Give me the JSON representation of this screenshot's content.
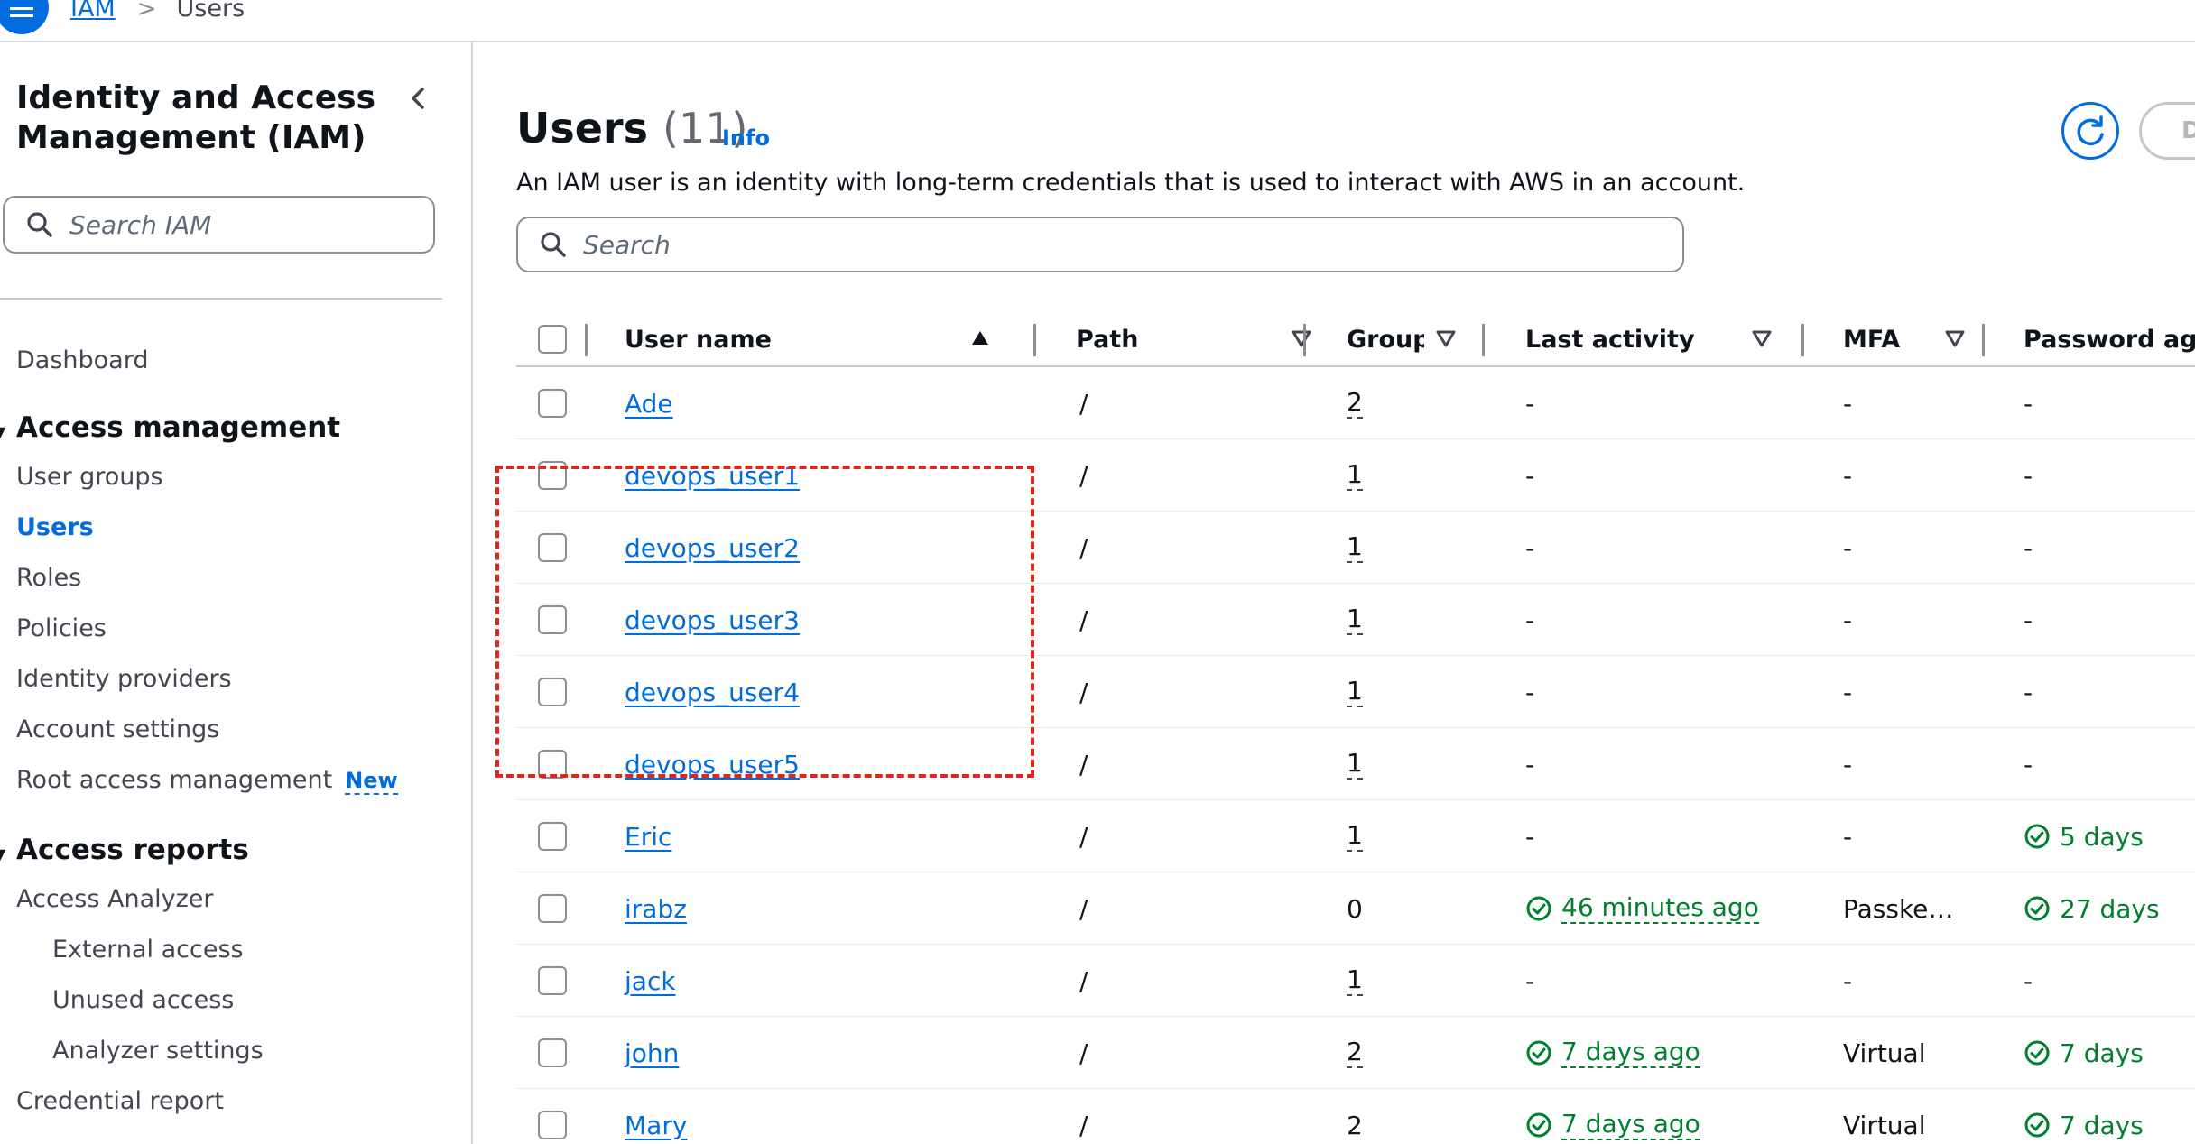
{
  "breadcrumb": {
    "root": "IAM",
    "separator": ">",
    "current": "Users"
  },
  "sidebar": {
    "title": "Identity and Access Management (IAM)",
    "search_placeholder": "Search IAM",
    "dashboard": "Dashboard",
    "access_management": {
      "heading": "Access management",
      "items": [
        "User groups",
        "Users",
        "Roles",
        "Policies",
        "Identity providers",
        "Account settings",
        "Root access management"
      ],
      "new_badge": "New"
    },
    "access_reports": {
      "heading": "Access reports",
      "analyzer": "Access Analyzer",
      "analyzer_items": [
        "External access",
        "Unused access",
        "Analyzer settings"
      ],
      "credential_report": "Credential report"
    }
  },
  "main": {
    "title": "Users",
    "count": "(11)",
    "info": "Info",
    "description": "An IAM user is an identity with long-term credentials that is used to interact with AWS in an account.",
    "search_placeholder": "Search",
    "partial_button": "D"
  },
  "table": {
    "columns": [
      "User name",
      "Path",
      "Groups",
      "Last activity",
      "MFA",
      "Password age"
    ],
    "rows": [
      {
        "name": "Ade",
        "path": "/",
        "groups": "2",
        "last_activity": "-",
        "mfa": "-",
        "password_age": "-"
      },
      {
        "name": "devops_user1",
        "path": "/",
        "groups": "1",
        "last_activity": "-",
        "mfa": "-",
        "password_age": "-"
      },
      {
        "name": "devops_user2",
        "path": "/",
        "groups": "1",
        "last_activity": "-",
        "mfa": "-",
        "password_age": "-"
      },
      {
        "name": "devops_user3",
        "path": "/",
        "groups": "1",
        "last_activity": "-",
        "mfa": "-",
        "password_age": "-"
      },
      {
        "name": "devops_user4",
        "path": "/",
        "groups": "1",
        "last_activity": "-",
        "mfa": "-",
        "password_age": "-"
      },
      {
        "name": "devops_user5",
        "path": "/",
        "groups": "1",
        "last_activity": "-",
        "mfa": "-",
        "password_age": "-"
      },
      {
        "name": "Eric",
        "path": "/",
        "groups": "1",
        "last_activity": "-",
        "mfa": "-",
        "password_age": "5 days"
      },
      {
        "name": "irabz",
        "path": "/",
        "groups": "0",
        "last_activity": "46 minutes ago",
        "mfa": "Passke…",
        "password_age": "27 days"
      },
      {
        "name": "jack",
        "path": "/",
        "groups": "1",
        "last_activity": "-",
        "mfa": "-",
        "password_age": "-"
      },
      {
        "name": "john",
        "path": "/",
        "groups": "2",
        "last_activity": "7 days ago",
        "mfa": "Virtual",
        "password_age": "7 days"
      },
      {
        "name": "Mary",
        "path": "/",
        "groups": "2",
        "last_activity": "7 days ago",
        "mfa": "Virtual",
        "password_age": "7 days"
      }
    ]
  },
  "colors": {
    "link": "#006ce0",
    "success": "#00802f",
    "annotation": "#e0251b"
  }
}
